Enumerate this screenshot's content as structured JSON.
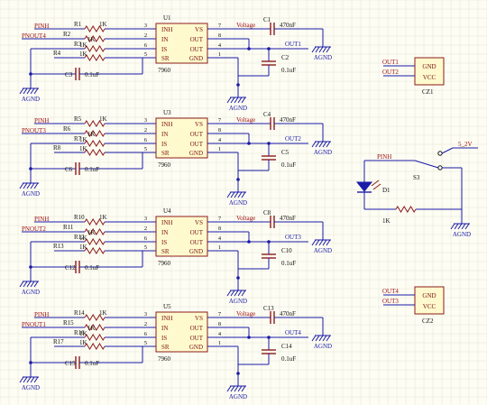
{
  "colors": {
    "background": "#fdfdf4",
    "grid": "#e4e4d6",
    "wire": "#1a1aa8",
    "component": "#8b1a1a",
    "label_red": "#a01010",
    "net_blue": "#1a1aa8",
    "ground": "#1a1aa8",
    "ic_fill": "#fffacd",
    "ic_text": "#7a1010",
    "pin_num": "#000000",
    "text": "#111111"
  },
  "channels": [
    {
      "ic_ref": "U1",
      "ic_part": "7960",
      "inputs": [
        "PINH",
        "PNOUT4"
      ],
      "resistors": [
        {
          "ref": "R1",
          "val": "1K"
        },
        {
          "ref": "R2",
          "val": "1K"
        },
        {
          "ref": "R3",
          "val": "1K"
        },
        {
          "ref": "R4",
          "val": "1K"
        }
      ],
      "cap_in": {
        "ref": "C3",
        "val": "0.1uF"
      },
      "voltage_label": "Voltage",
      "cap_out_series": {
        "ref": "C1",
        "val": "470nF"
      },
      "cap_out_shunt": {
        "ref": "C2",
        "val": "0.1uF"
      },
      "output_net": "OUT1",
      "gnd_labels": [
        "AGND",
        "AGND",
        "AGND"
      ]
    },
    {
      "ic_ref": "U3",
      "ic_part": "7960",
      "inputs": [
        "PINH",
        "PNOUT3"
      ],
      "resistors": [
        {
          "ref": "R5",
          "val": "1K"
        },
        {
          "ref": "R6",
          "val": "1K"
        },
        {
          "ref": "R7",
          "val": "1K"
        },
        {
          "ref": "R8",
          "val": "1K"
        }
      ],
      "cap_in": {
        "ref": "C6",
        "val": "0.1uF"
      },
      "voltage_label": "Voltage",
      "cap_out_series": {
        "ref": "C4",
        "val": "470nF"
      },
      "cap_out_shunt": {
        "ref": "C5",
        "val": "0.1uF"
      },
      "output_net": "OUT2",
      "gnd_labels": [
        "AGND",
        "AGND",
        "AGND"
      ]
    },
    {
      "ic_ref": "U4",
      "ic_part": "7960",
      "inputs": [
        "PINH",
        "PNOUT2"
      ],
      "resistors": [
        {
          "ref": "R10",
          "val": "1K"
        },
        {
          "ref": "R11",
          "val": "1K"
        },
        {
          "ref": "R12",
          "val": "1K"
        },
        {
          "ref": "R13",
          "val": "1K"
        }
      ],
      "cap_in": {
        "ref": "C12",
        "val": "0.1uF"
      },
      "voltage_label": "Voltage",
      "cap_out_series": {
        "ref": "C8",
        "val": "470nF"
      },
      "cap_out_shunt": {
        "ref": "C10",
        "val": "0.1uF"
      },
      "output_net": "OUT3",
      "gnd_labels": [
        "AGND",
        "AGND",
        "AGND"
      ]
    },
    {
      "ic_ref": "U5",
      "ic_part": "7960",
      "inputs": [
        "PINH",
        "PNOUT1"
      ],
      "resistors": [
        {
          "ref": "R14",
          "val": "1K"
        },
        {
          "ref": "R15",
          "val": "1K"
        },
        {
          "ref": "R16",
          "val": "1K"
        },
        {
          "ref": "R17",
          "val": "1K"
        }
      ],
      "cap_in": {
        "ref": "C15",
        "val": "0.1uF"
      },
      "voltage_label": "Voltage",
      "cap_out_series": {
        "ref": "C13",
        "val": "470nF"
      },
      "cap_out_shunt": {
        "ref": "C14",
        "val": "0.1uF"
      },
      "output_net": "OUT4",
      "gnd_labels": [
        "AGND",
        "AGND",
        "AGND"
      ]
    }
  ],
  "ic_pins": {
    "left": [
      {
        "name": "INH",
        "num": "3"
      },
      {
        "name": "IN",
        "num": "2"
      },
      {
        "name": "IS",
        "num": "6"
      },
      {
        "name": "SR",
        "num": "5"
      }
    ],
    "right": [
      {
        "name": "VS",
        "num": "7"
      },
      {
        "name": "OUT",
        "num": "8"
      },
      {
        "name": "OUT",
        "num": "4"
      },
      {
        "name": "GND",
        "num": "1"
      }
    ]
  },
  "connectors": [
    {
      "ref": "CZ1",
      "nets": [
        "OUT1",
        "OUT2"
      ],
      "pins": [
        "GND",
        "VCC"
      ]
    },
    {
      "ref": "CZ2",
      "nets": [
        "OUT4",
        "OUT3"
      ],
      "pins": [
        "GND",
        "VCC"
      ]
    }
  ],
  "indicator": {
    "net": "PINH",
    "switch_ref": "S3",
    "supply": "5_2V",
    "diode_ref": "D1",
    "resistor_val": "1K",
    "gnd_label": "AGND"
  }
}
